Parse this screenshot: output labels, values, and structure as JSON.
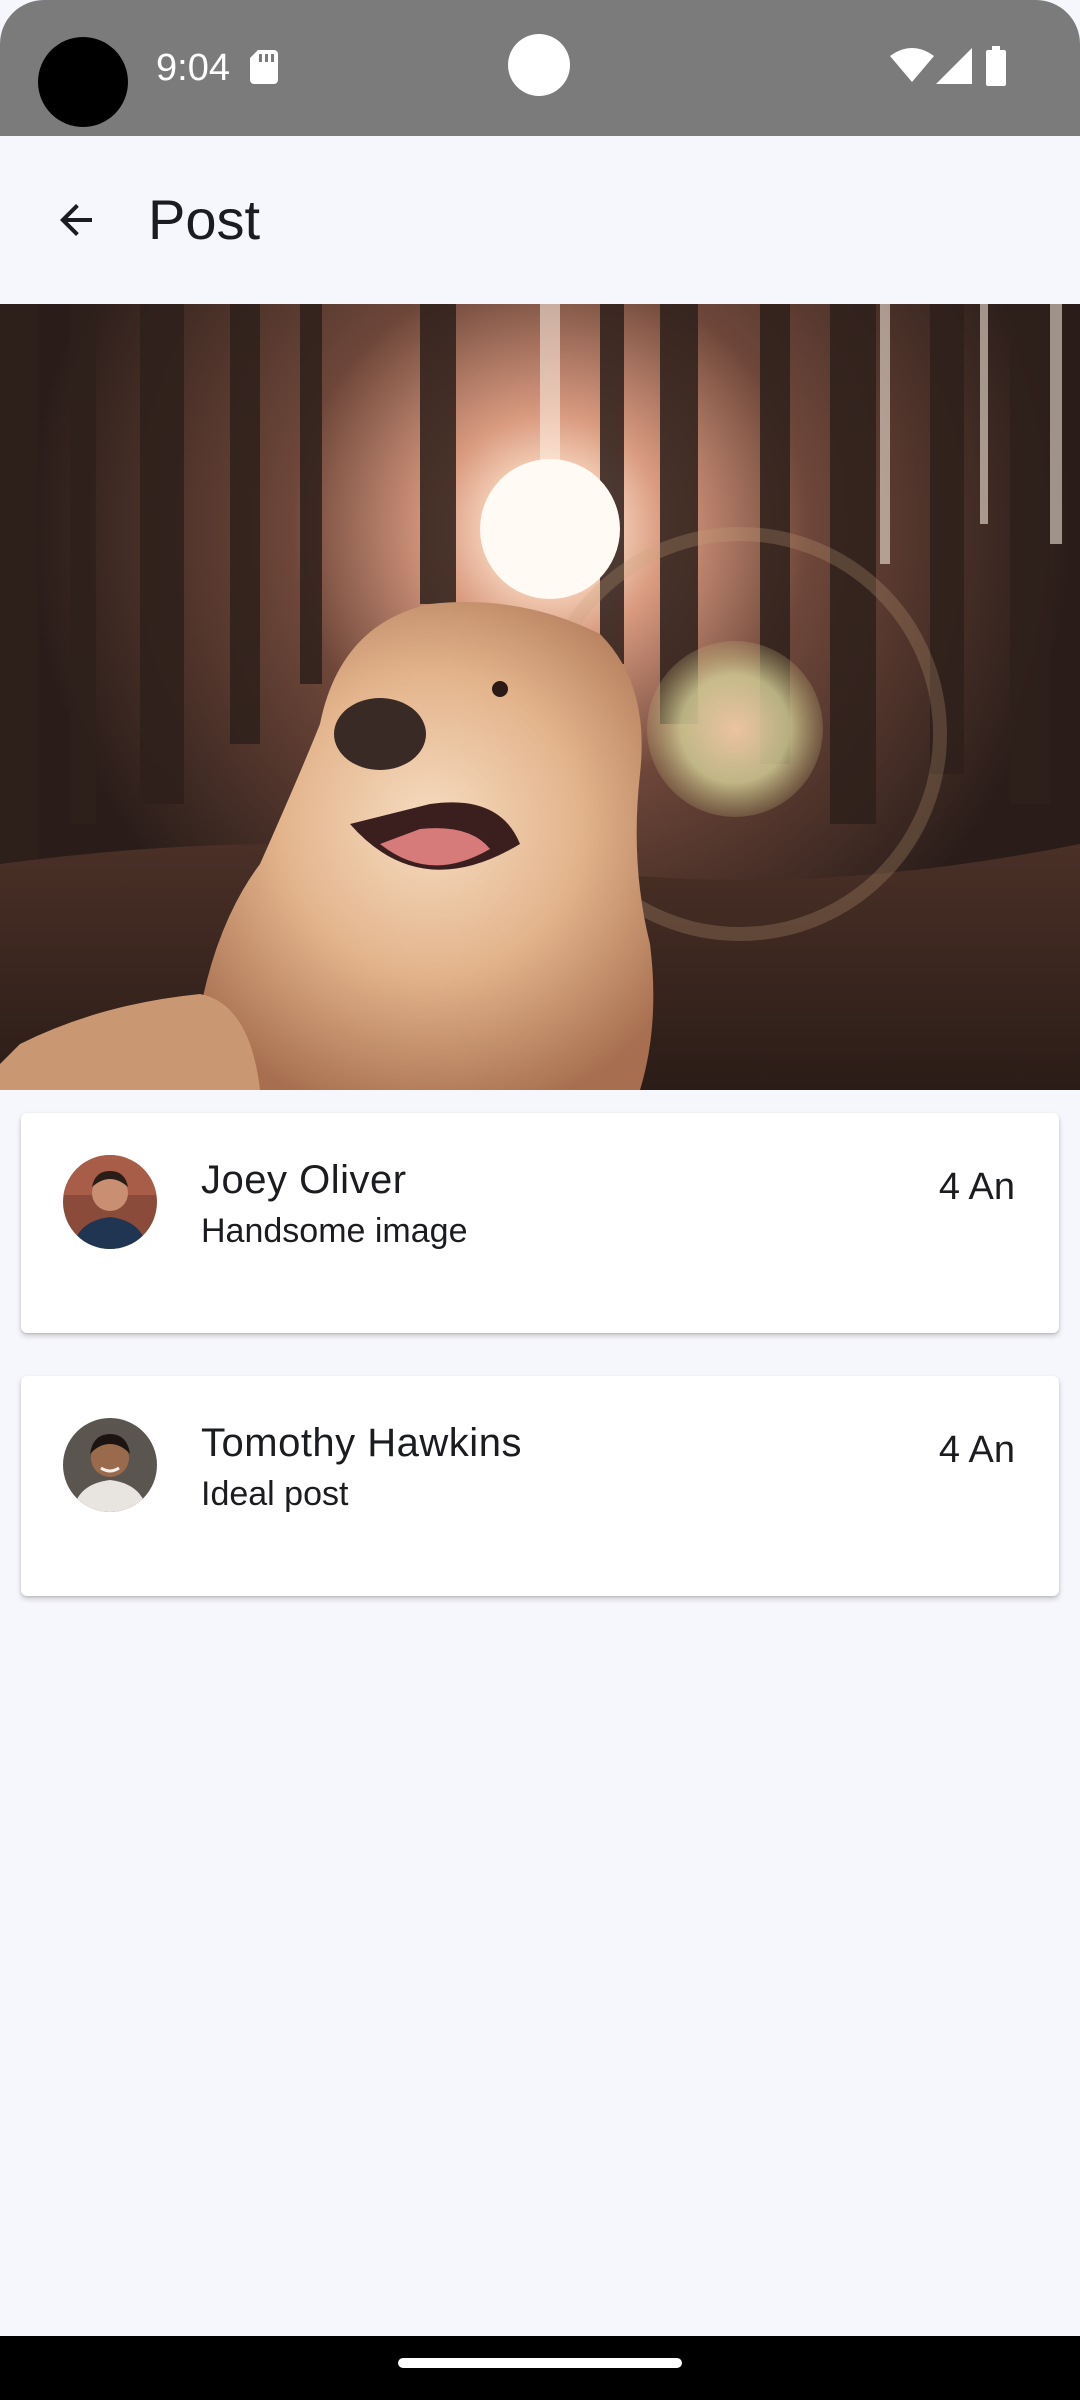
{
  "status_bar": {
    "time": "9:04",
    "icons": [
      "camera-cutout",
      "sd-card-icon",
      "wifi-icon",
      "signal-icon",
      "battery-icon"
    ]
  },
  "app_bar": {
    "title": "Post",
    "back_icon": "arrow-back-icon"
  },
  "hero": {
    "colors": {
      "forest": "#3b2a22",
      "glow": "#f8c8a8",
      "dog": "#e7b98f"
    }
  },
  "comments": [
    {
      "name": "Joey Oliver",
      "subtitle": "Handsome image",
      "time": "4 An"
    },
    {
      "name": "Tomothy Hawkins",
      "subtitle": "Ideal post",
      "time": "4 An"
    }
  ],
  "colors": {
    "background": "#f6f7fc",
    "status_bar": "#7b7b7b",
    "card": "#ffffff",
    "text": "#1b1c20"
  }
}
